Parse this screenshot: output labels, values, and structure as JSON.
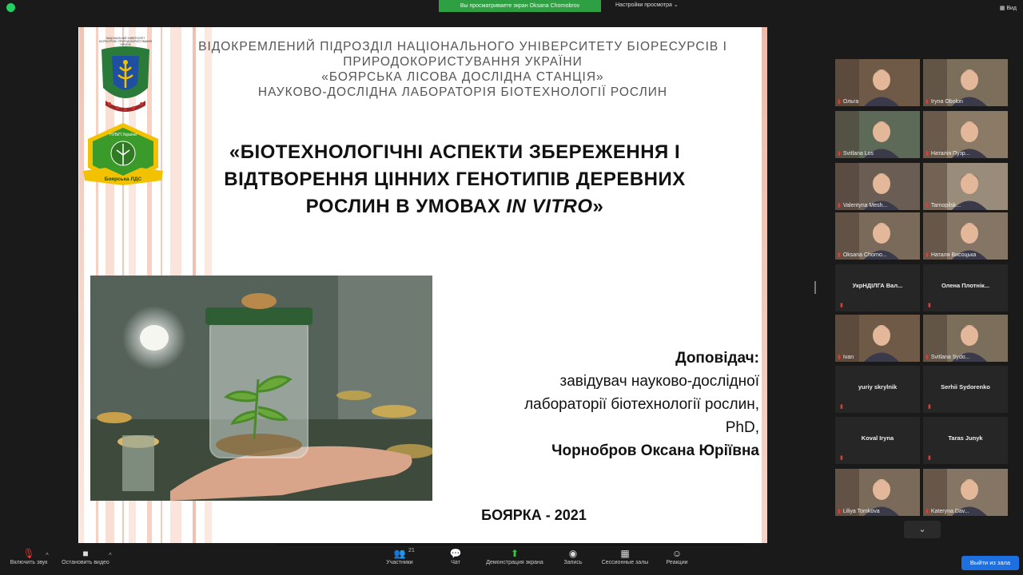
{
  "top_bar": {
    "share_banner": "Вы просматриваете экран Oksana Chornobrov",
    "view_settings": "Настройки просмотра",
    "view_button": "Вид"
  },
  "slide": {
    "header_lines": [
      "ВІДОКРЕМЛЕНИЙ ПІДРОЗДІЛ НАЦІОНАЛЬНОГО УНІВЕРСИТЕТУ БІОРЕСУРСІВ І",
      "ПРИРОДОКОРИСТУВАННЯ УКРАЇНИ",
      "«БОЯРСЬКА ЛІСОВА ДОСЛІДНА СТАНЦІЯ»",
      "НАУКОВО-ДОСЛІДНА ЛАБОРАТОРІЯ БІОТЕХНОЛОГІЇ РОСЛИН"
    ],
    "title_line1": "«БІОТЕХНОЛОГІЧНІ АСПЕКТИ ЗБЕРЕЖЕННЯ І",
    "title_line2": "ВІДТВОРЕННЯ ЦІННИХ ГЕНОТИПІВ ДЕРЕВНИХ",
    "title_line3_start": "РОСЛИН В УМОВАХ ",
    "title_line3_italic": "IN VITRO",
    "title_line3_end": "»",
    "speaker_label": "Доповідач:",
    "speaker_role_lines": [
      "завідувач науково-дослідної",
      "лабораторії біотехнології рослин,",
      "PhD,"
    ],
    "speaker_name": "Чорнобров Оксана Юріївна",
    "footer": "БОЯРКА - 2021",
    "logo1_text": "НАЦІОНАЛЬНИЙ УНІВЕРСИТЕТ БІОРЕСУРСІВ І ПРИРОДОКОРИСТУВАННЯ УКРАЇНИ",
    "logo2_top": "НУБіП України",
    "logo2_bottom": "Боярська ЛДС"
  },
  "participants": [
    {
      "name": "Ольга",
      "type": "video"
    },
    {
      "name": "Iryna Obolon",
      "type": "video"
    },
    {
      "name": "Svitlana Los",
      "type": "video"
    },
    {
      "name": "Наталія Пузр...",
      "type": "video"
    },
    {
      "name": "Valentyna Mesh...",
      "type": "video"
    },
    {
      "name": "Tarnopilsk...",
      "type": "video"
    },
    {
      "name": "Oksana Chorno...",
      "type": "video",
      "active": true
    },
    {
      "name": "Наталя Висоцька",
      "type": "video"
    },
    {
      "name": "УкрНДІЛГА Вал...",
      "type": "text"
    },
    {
      "name": "Олена Плотнік...",
      "type": "text"
    },
    {
      "name": "Ivan",
      "type": "video"
    },
    {
      "name": "Svitlana Sydo...",
      "type": "video"
    },
    {
      "name": "yuriy skrylnik",
      "type": "text"
    },
    {
      "name": "Serhii Sydorenko",
      "type": "text"
    },
    {
      "name": "Koval Iryna",
      "type": "text"
    },
    {
      "name": "Taras Junyk",
      "type": "text"
    },
    {
      "name": "Liliya Tomkova",
      "type": "video"
    },
    {
      "name": "Kateryna Dav...",
      "type": "video"
    }
  ],
  "toolbar": {
    "unmute": "Включить звук",
    "stop_video": "Остановить видео",
    "participants": "Участники",
    "participants_count": "21",
    "chat": "Чат",
    "share": "Демонстрация экрана",
    "record": "Запись",
    "breakout": "Сессионные залы",
    "reactions": "Реакции",
    "leave": "Выйти из зала"
  }
}
